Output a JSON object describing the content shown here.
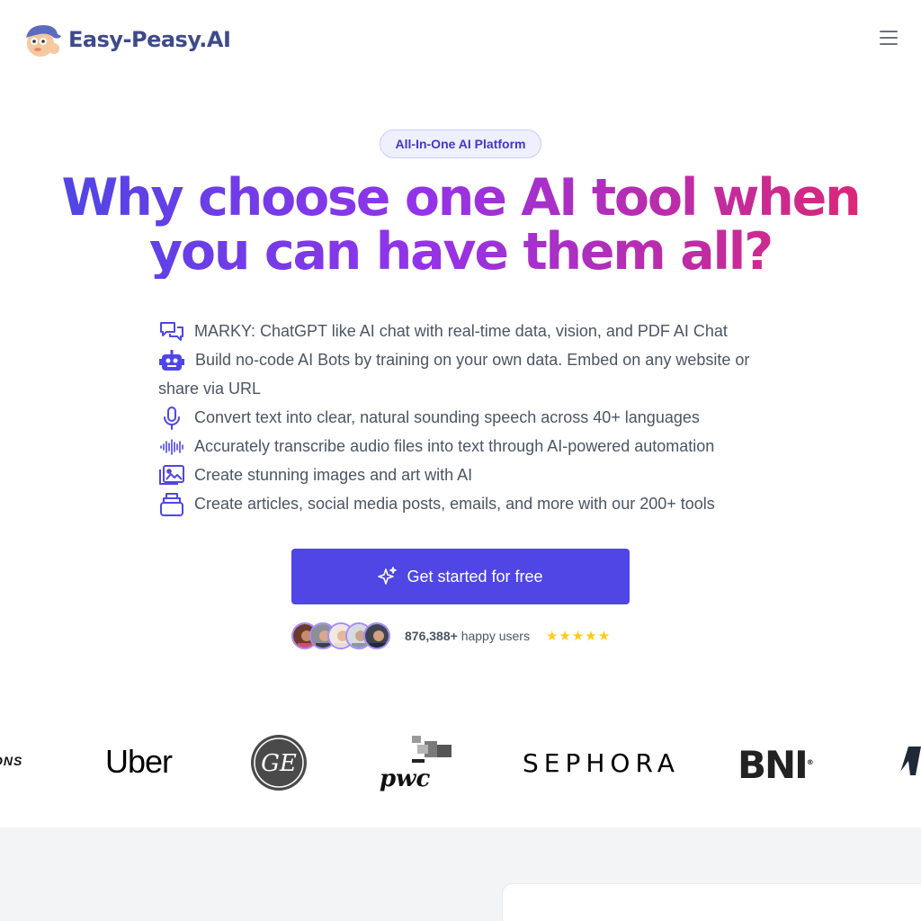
{
  "header": {
    "brand": "Easy-Peasy.AI",
    "menu_icon": "hamburger-menu-icon"
  },
  "hero": {
    "badge": "All-In-One AI Platform",
    "headline": "Why choose one AI tool when you can have them all?",
    "headline_gradient": [
      "#4f46e5",
      "#9333ea",
      "#db2777"
    ]
  },
  "features": [
    {
      "icon": "chat-bubbles-icon",
      "text": "MARKY: ChatGPT like AI chat with real-time data, vision, and PDF AI Chat"
    },
    {
      "icon": "robot-icon",
      "text": "Build no-code AI Bots by training on your own data. Embed on any website or share via URL"
    },
    {
      "icon": "microphone-icon",
      "text": "Convert text into clear, natural sounding speech across 40+ languages"
    },
    {
      "icon": "audio-waveform-icon",
      "text": "Accurately transcribe audio files into text through AI-powered automation"
    },
    {
      "icon": "images-icon",
      "text": "Create stunning images and art with AI"
    },
    {
      "icon": "stack-icon",
      "text": "Create articles, social media posts, emails, and more with our 200+ tools"
    }
  ],
  "cta": {
    "label": "Get started for free",
    "icon": "sparkles-icon",
    "color": "#4f46e5"
  },
  "social_proof": {
    "count": "876,388+",
    "suffix": "happy users",
    "stars": "★★★★★",
    "rating_stars": 5
  },
  "logos": {
    "partial_left": "ONS",
    "uber": "Uber",
    "ge": "GE",
    "pwc": "pwc",
    "sephora": "SEPHORA",
    "bni": "BNI",
    "bni_mark": "®"
  }
}
